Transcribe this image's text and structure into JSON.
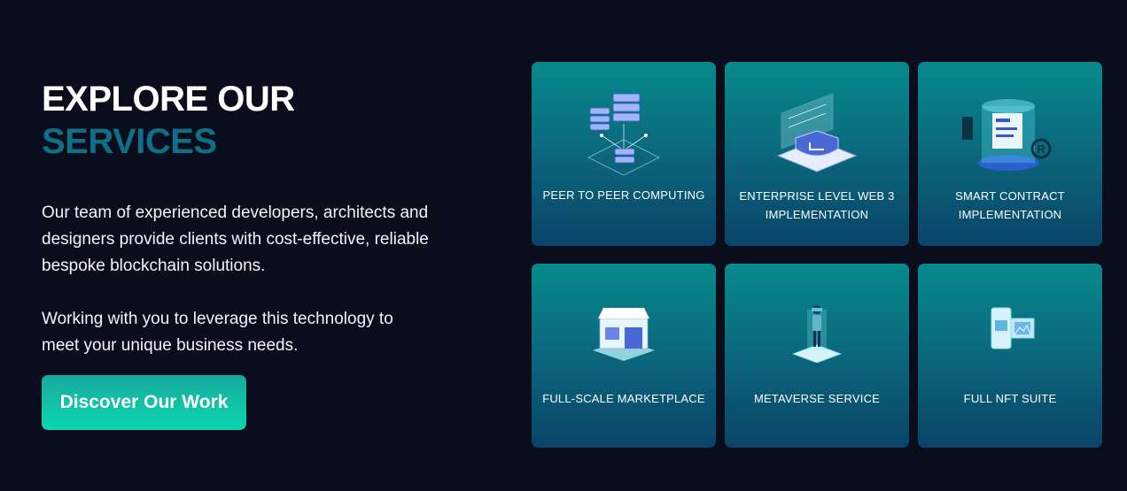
{
  "heading": {
    "line1": "EXPLORE OUR",
    "line2": "SERVICES"
  },
  "paragraphs": [
    "Our team of experienced developers, architects and designers provide clients with cost-effective, reliable bespoke blockchain solutions.",
    "Working with you to leverage this technology to meet your unique business needs."
  ],
  "cta": {
    "label": "Discover Our Work"
  },
  "colors": {
    "background": "#0a0e1c",
    "accent_heading": "#0f6f86",
    "button": "#11c3a6",
    "card_top": "#078a8c",
    "card_bottom": "#0a4468"
  },
  "services": [
    {
      "title": "PEER TO PEER COMPUTING",
      "icon": "server-network-icon"
    },
    {
      "title": "ENTERPRISE LEVEL WEB 3 IMPLEMENTATION",
      "icon": "shield-platform-icon"
    },
    {
      "title": "SMART CONTRACT IMPLEMENTATION",
      "icon": "contract-hologram-icon"
    },
    {
      "title": "FULL-SCALE MARKETPLACE",
      "icon": "storefront-icon"
    },
    {
      "title": "METAVERSE SERVICE",
      "icon": "vr-person-icon"
    },
    {
      "title": "FULL NFT SUITE",
      "icon": "nft-frames-icon"
    }
  ]
}
